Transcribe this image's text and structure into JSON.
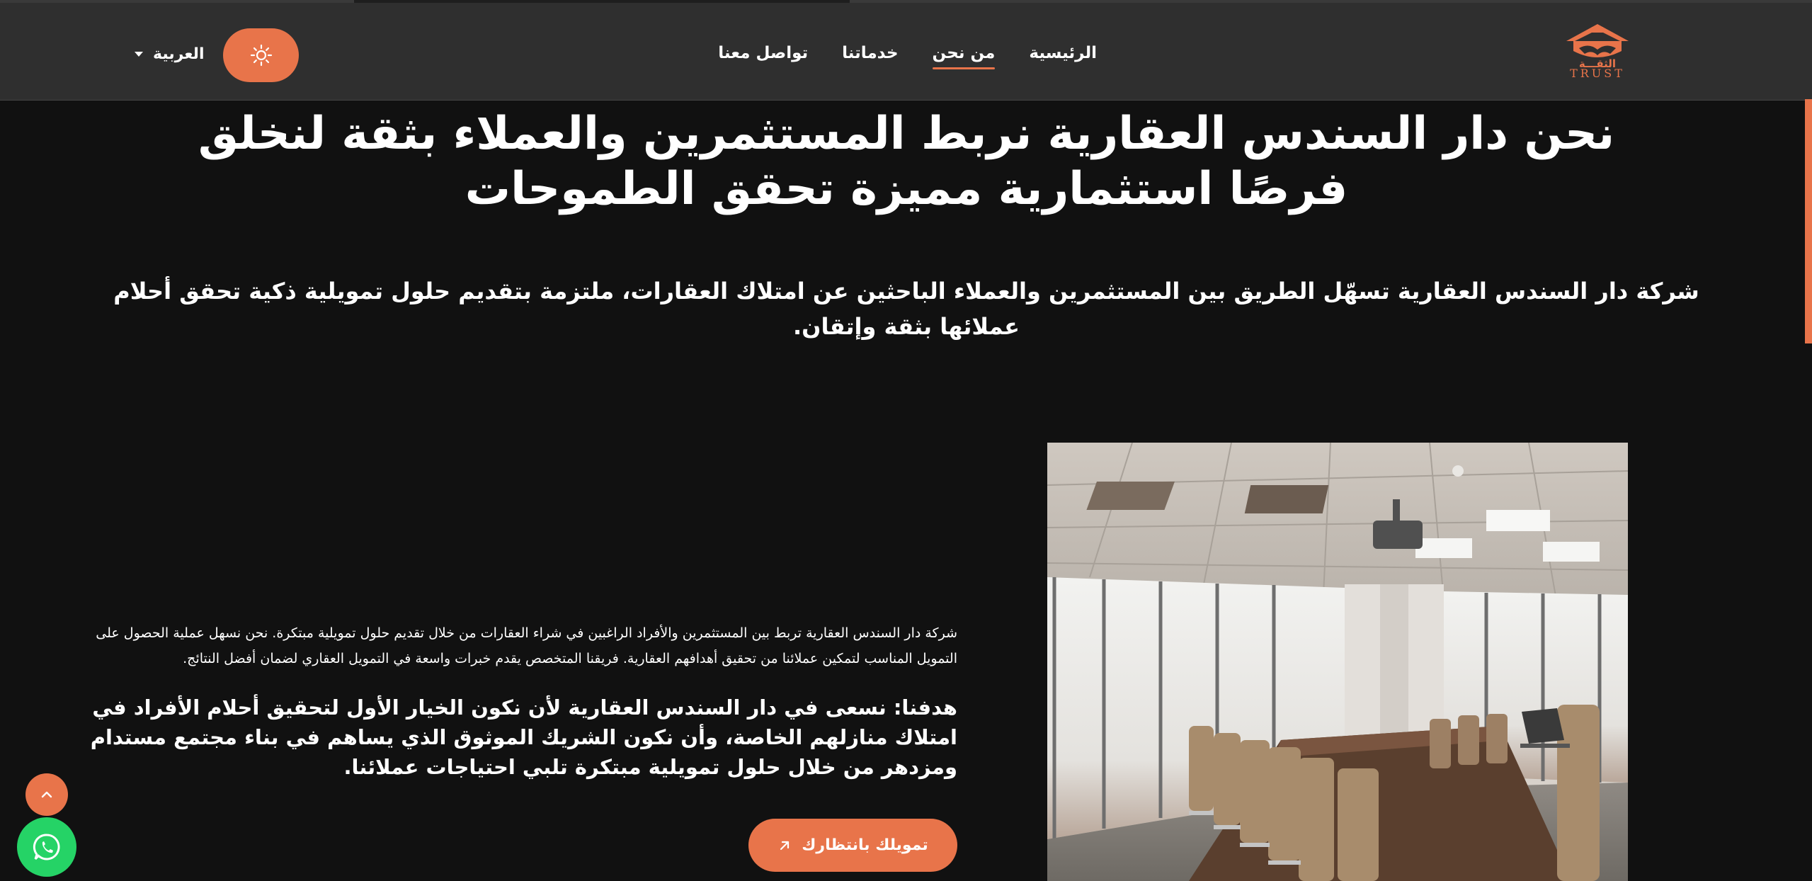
{
  "header": {
    "logo_text": "TRUST",
    "logo_arabic": "الثقـــة",
    "nav": [
      {
        "label": "الرئيسية",
        "active": false
      },
      {
        "label": "من نحن",
        "active": true
      },
      {
        "label": "خدماتنا",
        "active": false
      },
      {
        "label": "تواصل معنا",
        "active": false
      }
    ],
    "theme_icon": "sun-icon",
    "language": "العربية"
  },
  "hero": {
    "title": "نحن دار السندس العقارية نربط المستثمرين والعملاء بثقة لنخلق فرصًا استثمارية مميزة تحقق الطموحات",
    "subtitle": "شركة دار السندس العقارية تسهّل الطريق بين المستثمرين والعملاء الباحثين عن امتلاك العقارات، ملتزمة بتقديم حلول تمويلية ذكية تحقق أحلام عملائها بثقة وإتقان."
  },
  "about": {
    "description": "شركة دار السندس العقارية تربط بين المستثمرين والأفراد الراغبين في شراء العقارات من خلال تقديم حلول تمويلية مبتكرة. نحن نسهل عملية الحصول على التمويل المناسب لتمكين عملائنا من تحقيق أهدافهم العقارية. فريقنا المتخصص يقدم خبرات واسعة في التمويل العقاري لضمان أفضل النتائج.",
    "goal": "هدفنا: نسعى في دار السندس العقارية لأن نكون الخيار الأول لتحقيق أحلام الأفراد في امتلاك منازلهم الخاصة، وأن نكون الشريك الموثوق الذي يساهم في بناء مجتمع مستدام ومزدهر من خلال حلول تمويلية مبتكرة تلبي احتياجات عملائنا.",
    "cta_label": "تمويلك بانتظارك",
    "cta_icon": "arrow-up-right-icon",
    "image": "conference-room-photo"
  },
  "floating": {
    "scroll_top_icon": "chevron-up-icon",
    "whatsapp_icon": "whatsapp-icon"
  },
  "colors": {
    "accent": "#e8744a",
    "background": "#111111",
    "header": "#2f2f2f",
    "whatsapp": "#25d366"
  }
}
